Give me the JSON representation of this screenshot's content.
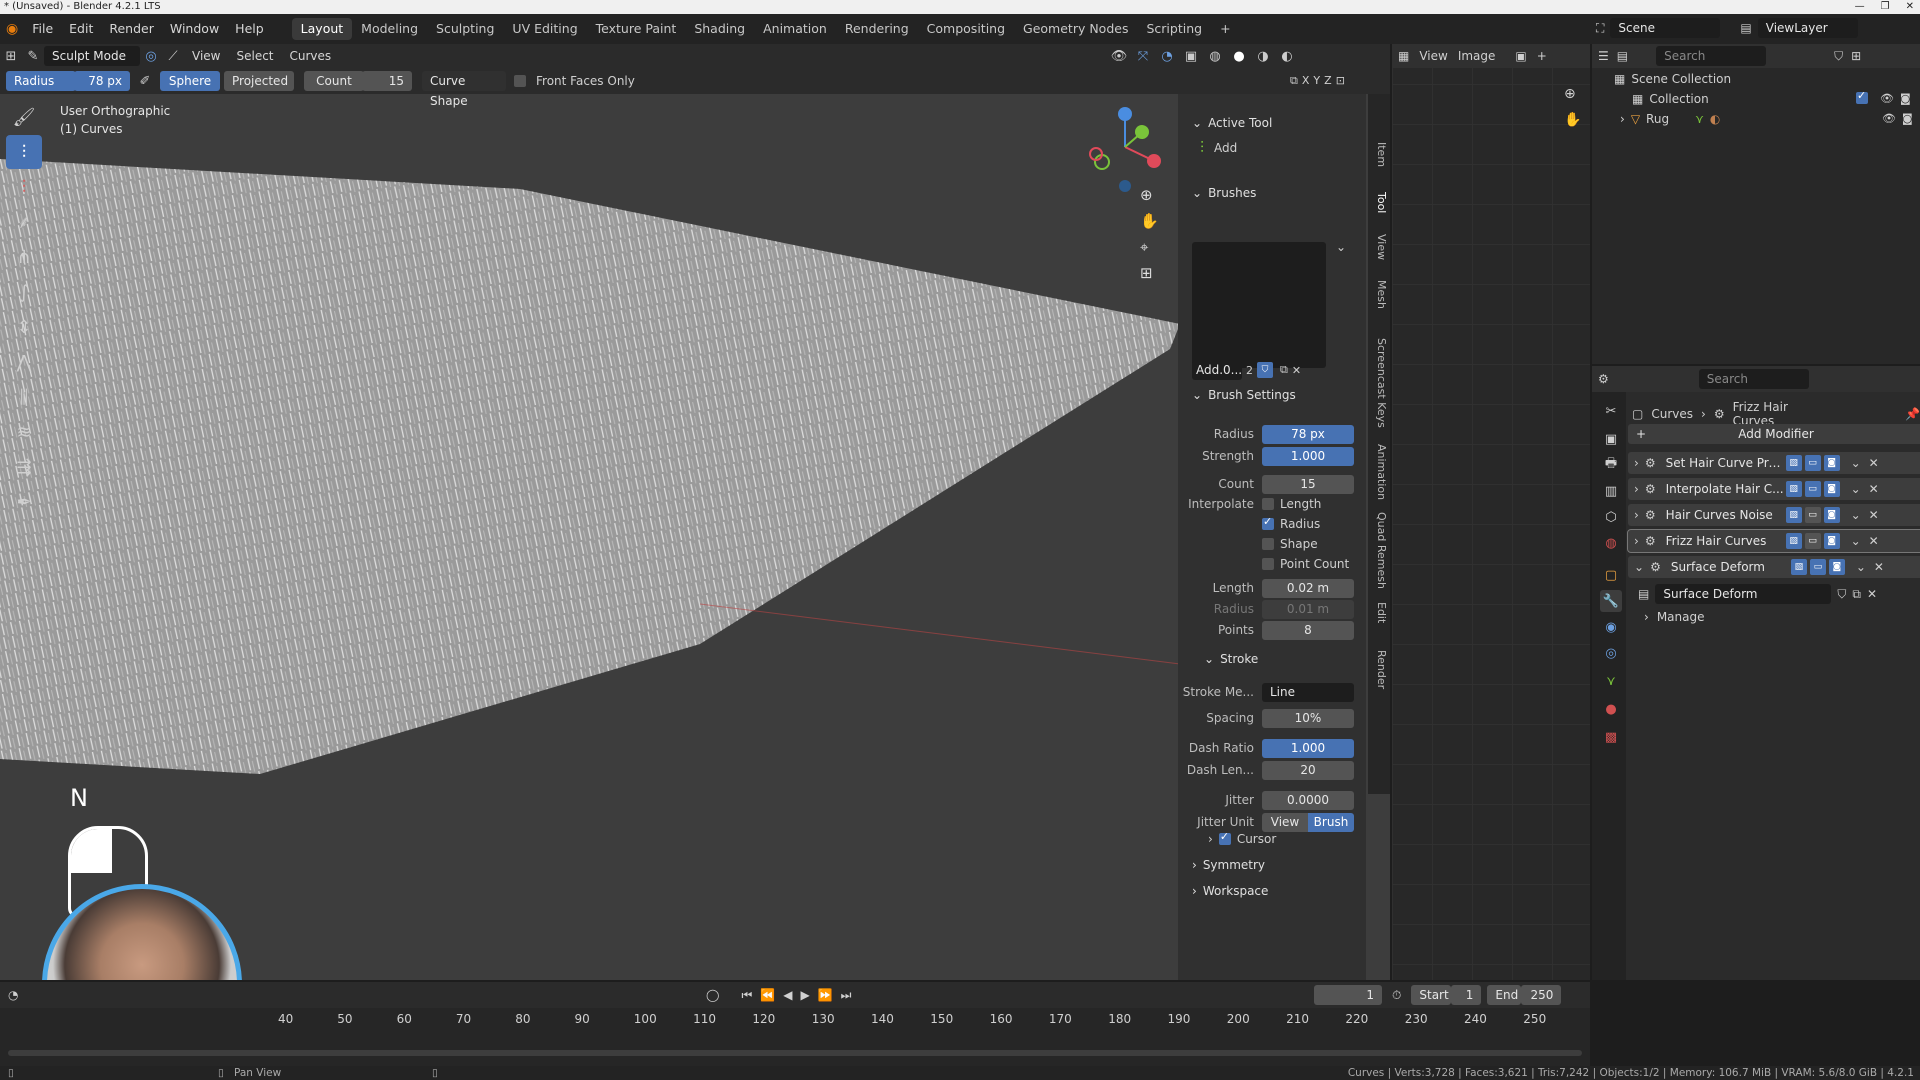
{
  "title_bar": {
    "text": "* (Unsaved) - Blender 4.2.1 LTS"
  },
  "menu": {
    "items": [
      "File",
      "Edit",
      "Render",
      "Window",
      "Help"
    ]
  },
  "workspaces": {
    "tabs": [
      "Layout",
      "Modeling",
      "Sculpting",
      "UV Editing",
      "Texture Paint",
      "Shading",
      "Animation",
      "Rendering",
      "Compositing",
      "Geometry Nodes",
      "Scripting"
    ],
    "active": "Layout"
  },
  "scene": {
    "label": "Scene",
    "view_layer": "ViewLayer"
  },
  "viewport_header": {
    "mode": "Sculpt Mode",
    "menus": [
      "View",
      "Select",
      "Curves"
    ]
  },
  "tool_settings": {
    "radius_label": "Radius",
    "radius_value": "78 px",
    "sphere": "Sphere",
    "projected": "Projected",
    "count_label": "Count",
    "count_value": "15",
    "curve_shape": "Curve Shape",
    "front_faces": "Front Faces Only",
    "axes": [
      "X",
      "Y",
      "Z"
    ]
  },
  "viewport": {
    "view_name": "User Orthographic",
    "object_name": "(1) Curves",
    "key_overlay": "N",
    "accent_color": "#4772b3"
  },
  "n_panel": {
    "active_tool": {
      "title": "Active Tool",
      "tool_name": "Add"
    },
    "brushes": {
      "title": "Brushes",
      "brush_name": "Add.0...",
      "users": "2"
    },
    "brush_settings": {
      "title": "Brush Settings",
      "radius_label": "Radius",
      "radius_value": "78 px",
      "strength_label": "Strength",
      "strength_value": "1.000",
      "count_label": "Count",
      "count_value": "15",
      "interpolate_label": "Interpolate",
      "interp_length": "Length",
      "interp_radius": "Radius",
      "interp_shape": "Shape",
      "interp_point_count": "Point Count",
      "length_label": "Length",
      "length_value": "0.02 m",
      "radius2_label": "Radius",
      "radius2_value": "0.01 m",
      "points_label": "Points",
      "points_value": "8"
    },
    "stroke": {
      "title": "Stroke",
      "method_label": "Stroke Me...",
      "method_value": "Line",
      "spacing_label": "Spacing",
      "spacing_value": "10%",
      "dash_ratio_label": "Dash Ratio",
      "dash_ratio_value": "1.000",
      "dash_len_label": "Dash Len...",
      "dash_len_value": "20",
      "jitter_label": "Jitter",
      "jitter_value": "0.0000",
      "jitter_unit_label": "Jitter Unit",
      "jitter_view": "View",
      "jitter_brush": "Brush",
      "cursor": "Cursor"
    },
    "symmetry": "Symmetry",
    "workspace": "Workspace",
    "side_tabs": [
      "Item",
      "Tool",
      "View",
      "Mesh",
      "Screencast Keys",
      "Animation",
      "Quad Remesh",
      "Edit",
      "Render"
    ]
  },
  "image_editor": {
    "menus": [
      "View",
      "Image"
    ]
  },
  "outliner": {
    "search_placeholder": "Search",
    "scene_collection": "Scene Collection",
    "collection": "Collection",
    "rug": "Rug"
  },
  "properties": {
    "search_placeholder": "Search",
    "breadcrumb_obj": "Curves",
    "breadcrumb_mod": "Frizz Hair Curves",
    "add_modifier": "Add Modifier",
    "modifiers": [
      "Set Hair Curve Pro...",
      "Interpolate Hair C...",
      "Hair Curves Noise",
      "Frizz Hair Curves",
      "Surface Deform"
    ],
    "surface_deform_sub": "Surface Deform",
    "manage": "Manage"
  },
  "timeline": {
    "current_frame": "1",
    "start_label": "Start",
    "start_value": "1",
    "end_label": "End",
    "end_value": "250",
    "ticks": [
      "40",
      "50",
      "60",
      "70",
      "80",
      "90",
      "100",
      "110",
      "120",
      "130",
      "140",
      "150",
      "160",
      "170",
      "180",
      "190",
      "200",
      "210",
      "220",
      "230",
      "240",
      "250"
    ]
  },
  "status_bar": {
    "pan_view": "Pan View",
    "stats": "Curves | Verts:3,728 | Faces:3,621 | Tris:7,242 | Objects:1/2 | Memory: 106.7 MiB | VRAM: 5.6/8.0 GiB | 4.2.1"
  }
}
